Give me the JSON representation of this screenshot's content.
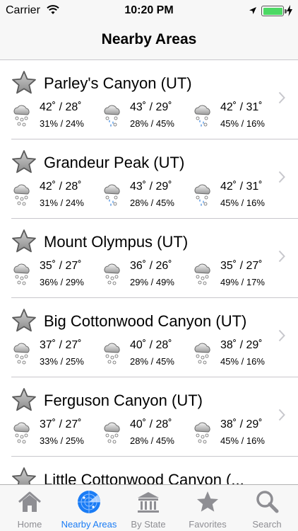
{
  "status": {
    "carrier": "Carrier",
    "time": "10:20 PM"
  },
  "nav": {
    "title": "Nearby Areas"
  },
  "areas": [
    {
      "name": "Parley's Canyon (UT)",
      "forecasts": [
        {
          "temps": "42˚ / 28˚",
          "precip": "31% / 24%"
        },
        {
          "temps": "43˚ / 29˚",
          "precip": "28% / 45%"
        },
        {
          "temps": "42˚ / 31˚",
          "precip": "45% / 16%"
        }
      ]
    },
    {
      "name": "Grandeur Peak (UT)",
      "forecasts": [
        {
          "temps": "42˚ / 28˚",
          "precip": "31% / 24%"
        },
        {
          "temps": "43˚ / 29˚",
          "precip": "28% / 45%"
        },
        {
          "temps": "42˚ / 31˚",
          "precip": "45% / 16%"
        }
      ]
    },
    {
      "name": "Mount Olympus (UT)",
      "forecasts": [
        {
          "temps": "35˚ / 27˚",
          "precip": "36% / 29%"
        },
        {
          "temps": "36˚ / 26˚",
          "precip": "29% / 49%"
        },
        {
          "temps": "35˚ / 27˚",
          "precip": "49% / 17%"
        }
      ]
    },
    {
      "name": "Big Cottonwood Canyon (UT)",
      "forecasts": [
        {
          "temps": "37˚ / 27˚",
          "precip": "33% / 25%"
        },
        {
          "temps": "40˚ / 28˚",
          "precip": "28% / 45%"
        },
        {
          "temps": "38˚ / 29˚",
          "precip": "45% / 16%"
        }
      ]
    },
    {
      "name": "Ferguson Canyon (UT)",
      "forecasts": [
        {
          "temps": "37˚ / 27˚",
          "precip": "33% / 25%"
        },
        {
          "temps": "40˚ / 28˚",
          "precip": "28% / 45%"
        },
        {
          "temps": "38˚ / 29˚",
          "precip": "45% / 16%"
        }
      ]
    },
    {
      "name": "Little Cottonwood Canyon (...",
      "forecasts": []
    }
  ],
  "tabs": [
    {
      "label": "Home",
      "icon": "home-icon"
    },
    {
      "label": "Nearby Areas",
      "icon": "radar-icon"
    },
    {
      "label": "By State",
      "icon": "capitol-building-icon"
    },
    {
      "label": "Favorites",
      "icon": "star-icon"
    },
    {
      "label": "Search",
      "icon": "search-icon"
    }
  ],
  "colors": {
    "accent": "#1a7cf5",
    "battery": "#4cd964",
    "inactive": "#8e8e93"
  }
}
